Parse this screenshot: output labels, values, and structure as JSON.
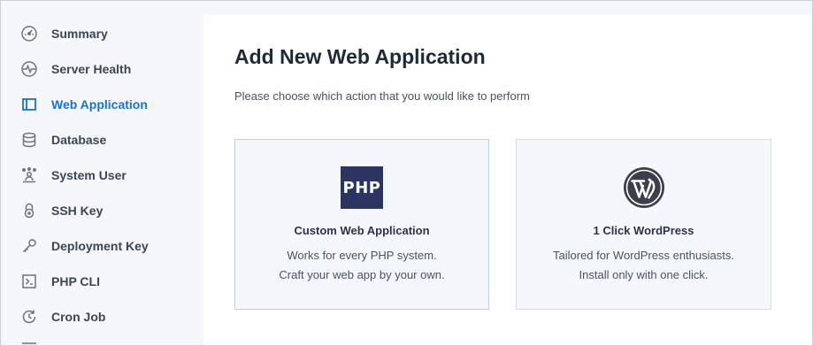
{
  "sidebar": {
    "items": [
      {
        "label": "Summary",
        "icon": "dashboard-gauge-icon",
        "active": false
      },
      {
        "label": "Server Health",
        "icon": "heartbeat-icon",
        "active": false
      },
      {
        "label": "Web Application",
        "icon": "browser-window-icon",
        "active": true
      },
      {
        "label": "Database",
        "icon": "database-icon",
        "active": false
      },
      {
        "label": "System User",
        "icon": "user-network-icon",
        "active": false
      },
      {
        "label": "SSH Key",
        "icon": "padlock-icon",
        "active": false
      },
      {
        "label": "Deployment Key",
        "icon": "key-icon",
        "active": false
      },
      {
        "label": "PHP CLI",
        "icon": "terminal-icon",
        "active": false
      },
      {
        "label": "Cron Job",
        "icon": "clock-refresh-icon",
        "active": false
      }
    ]
  },
  "main": {
    "title": "Add New Web Application",
    "subtitle": "Please choose which action that you would like to perform",
    "cards": [
      {
        "logo_text": "PHP",
        "title": "Custom Web Application",
        "desc_line1": "Works for every PHP system.",
        "desc_line2": "Craft your web app by your own."
      },
      {
        "logo_icon": "wordpress-logo-icon",
        "title": "1 Click WordPress",
        "desc_line1": "Tailored for WordPress enthusiasts.",
        "desc_line2": "Install only with one click."
      }
    ]
  },
  "colors": {
    "accent": "#1a73c9",
    "sidebar_bg": "#f5f7fa",
    "php_logo_bg": "#2c3560",
    "wordpress_logo": "#3a3f4b"
  }
}
